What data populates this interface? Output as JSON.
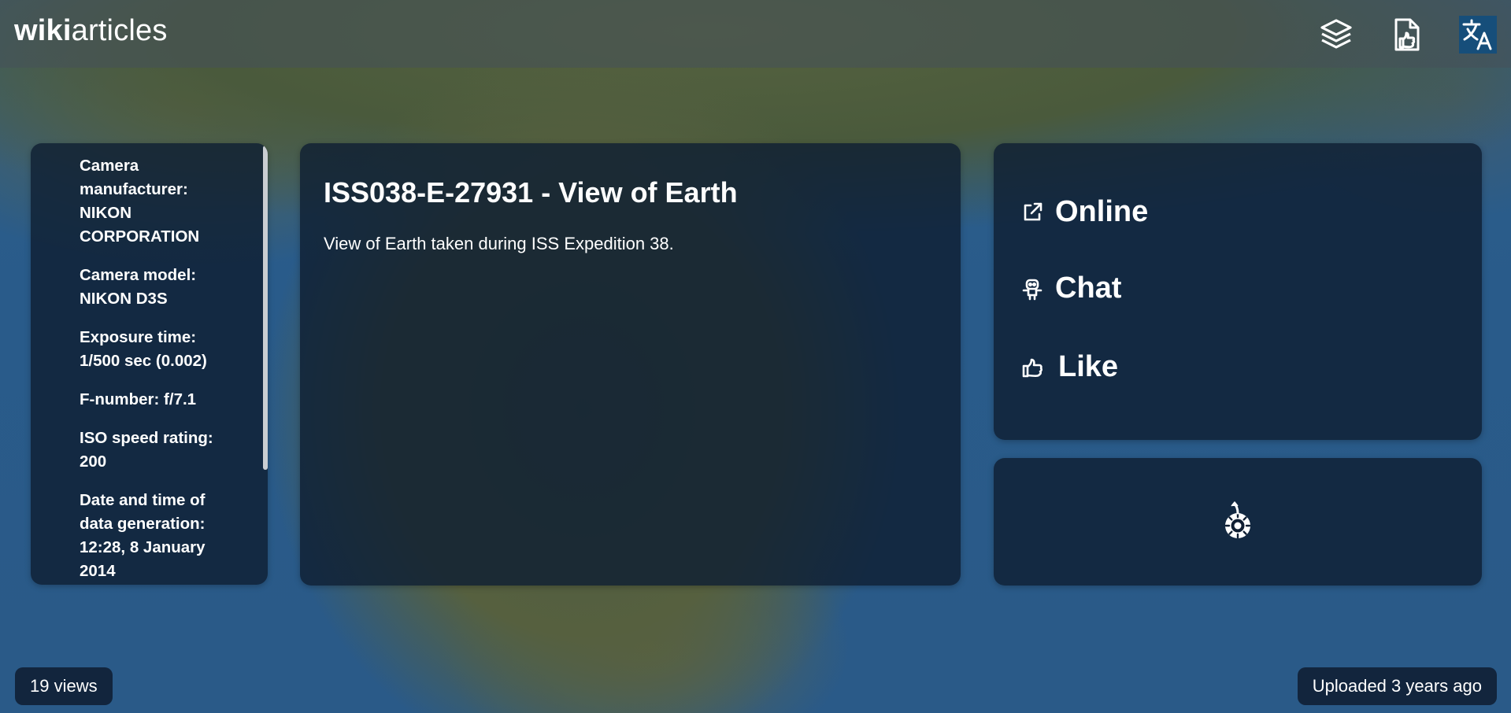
{
  "header": {
    "logo_bold": "wiki",
    "logo_light": "articles",
    "icons": [
      "layers-icon",
      "file-like-icon",
      "translate-icon"
    ]
  },
  "exif": {
    "items": [
      "Camera manufacturer: NIKON CORPORATION",
      "Camera model: NIKON D3S",
      "Exposure time: 1/500 sec (0.002)",
      "F-number: f/7.1",
      "ISO speed rating: 200",
      "Date and time of data generation: 12:28, 8 January 2014"
    ]
  },
  "article": {
    "title": "ISS038-E-27931 - View of Earth",
    "description": "View of Earth taken during ISS Expedition 38."
  },
  "actions": {
    "online_label": "Online",
    "chat_label": "Chat",
    "like_label": "Like"
  },
  "footer": {
    "views": "19 views",
    "uploaded": "Uploaded 3 years ago"
  },
  "colors": {
    "panel": "#0f1e32",
    "accent_translate": "#164e7a"
  }
}
